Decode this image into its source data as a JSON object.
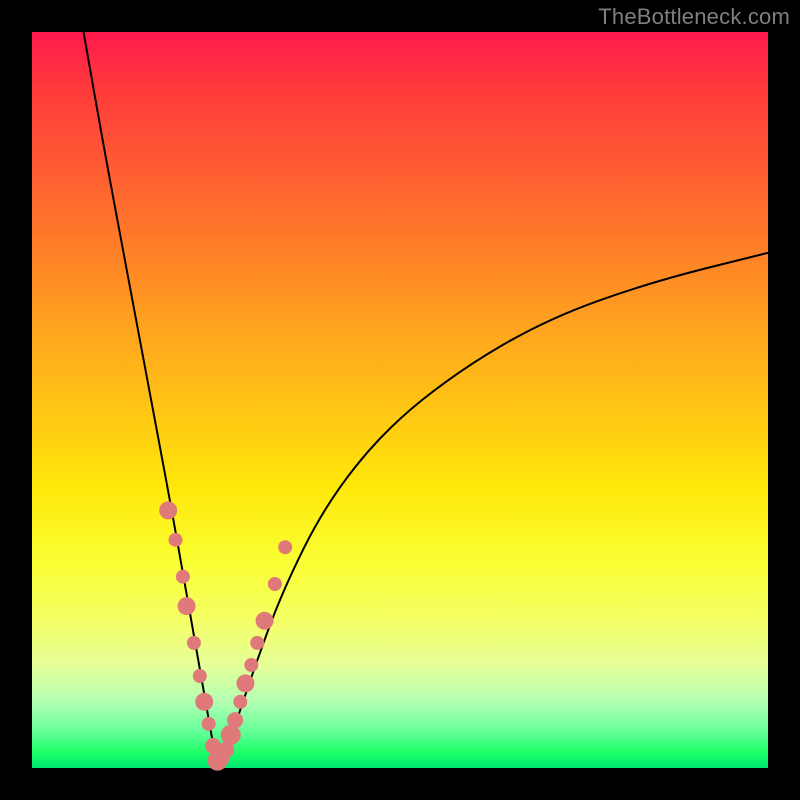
{
  "watermark": "TheBottleneck.com",
  "colors": {
    "frame": "#000000",
    "curve": "#000000",
    "dots": "#e07a7a",
    "gradient_top": "#ff1a4d",
    "gradient_bottom": "#00e673"
  },
  "chart_data": {
    "type": "line",
    "title": "",
    "xlabel": "",
    "ylabel": "",
    "xlim": [
      0,
      100
    ],
    "ylim": [
      0,
      100
    ],
    "notes": "V-shaped bottleneck curve on a vertical rainbow gradient (red=high bottleneck, green=low). Minimum near x≈25. Left branch near-vertical from (7,100)→(25,0). Right branch asymptotic toward ~70 at x=100.",
    "series": [
      {
        "name": "bottleneck-curve",
        "x": [
          7,
          10,
          13,
          16,
          19,
          22,
          25,
          27,
          30,
          34,
          40,
          48,
          58,
          70,
          84,
          100
        ],
        "y": [
          100,
          83,
          67,
          51,
          35,
          18,
          1,
          4,
          13,
          24,
          36,
          46,
          54,
          61,
          66,
          70
        ]
      }
    ],
    "points": {
      "name": "sample-dots",
      "comment": "Scatter of points clustered near the valley along both branches.",
      "x": [
        18.5,
        19.5,
        20.5,
        21.0,
        22.0,
        22.8,
        23.4,
        24.0,
        24.6,
        25.2,
        25.8,
        26.4,
        27.0,
        27.6,
        28.3,
        29.0,
        29.8,
        30.6,
        31.6,
        33.0,
        34.4
      ],
      "y": [
        35.0,
        31.0,
        26.0,
        22.0,
        17.0,
        12.5,
        9.0,
        6.0,
        3.0,
        1.0,
        1.5,
        2.5,
        4.5,
        6.5,
        9.0,
        11.5,
        14.0,
        17.0,
        20.0,
        25.0,
        30.0
      ]
    }
  }
}
